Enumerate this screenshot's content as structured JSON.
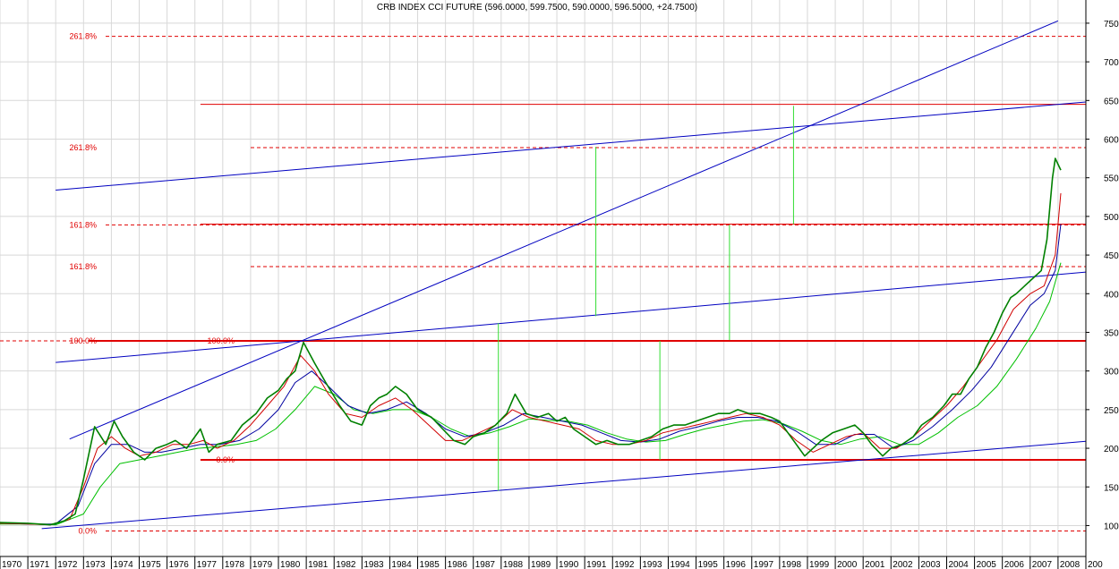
{
  "chart_data": {
    "type": "line",
    "title": "CRB INDEX CCI FUTURE (596.0000, 599.7500, 590.0000, 596.5000, +24.7500)",
    "xlim": [
      1970,
      2009
    ],
    "ylim": [
      60,
      780
    ],
    "y_ticks": [
      100,
      150,
      200,
      250,
      300,
      350,
      400,
      450,
      500,
      550,
      600,
      650,
      700,
      750
    ],
    "x_ticks": [
      "1970",
      "1971",
      "1972",
      "1973",
      "1974",
      "1975",
      "1976",
      "1977",
      "1978",
      "1979",
      "1980",
      "1981",
      "1982",
      "1983",
      "1984",
      "1985",
      "1986",
      "1987",
      "1988",
      "1989",
      "1990",
      "1991",
      "1992",
      "1993",
      "1994",
      "1995",
      "1996",
      "1997",
      "1998",
      "1999",
      "2000",
      "2001",
      "2002",
      "2003",
      "2004",
      "2005",
      "2006",
      "2007",
      "2008",
      "200"
    ],
    "grid": true,
    "series": [
      {
        "color": "#008000",
        "x": [
          1970,
          1971,
          1971.8,
          1972.3,
          1972.7,
          1973.0,
          1973.4,
          1973.8,
          1974.1,
          1974.4,
          1974.8,
          1975.2,
          1975.6,
          1976.0,
          1976.3,
          1976.7,
          1977.2,
          1977.5,
          1977.8,
          1978.3,
          1978.7,
          1979.2,
          1979.6,
          1980.0,
          1980.3,
          1980.6,
          1980.9,
          1981.3,
          1981.7,
          1982.2,
          1982.6,
          1983.0,
          1983.3,
          1983.6,
          1983.9,
          1984.2,
          1984.6,
          1985.0,
          1985.5,
          1985.9,
          1986.3,
          1986.7,
          1987.0,
          1987.4,
          1987.8,
          1988.2,
          1988.5,
          1988.9,
          1989.3,
          1989.7,
          1990.0,
          1990.3,
          1990.6,
          1991.0,
          1991.4,
          1991.8,
          1992.2,
          1992.6,
          1993.0,
          1993.4,
          1993.8,
          1994.2,
          1994.6,
          1995.0,
          1995.4,
          1995.8,
          1996.2,
          1996.5,
          1996.9,
          1997.3,
          1997.7,
          1998.0,
          1998.3,
          1998.6,
          1998.9,
          1999.2,
          1999.5,
          1999.9,
          2000.3,
          2000.7,
          2001.0,
          2001.3,
          2001.7,
          2002.0,
          2002.4,
          2002.8,
          2003.1,
          2003.5,
          2003.9,
          2004.2,
          2004.5,
          2004.8,
          2005.1,
          2005.4,
          2005.7,
          2006.0,
          2006.3,
          2006.5,
          2006.8,
          2007.1,
          2007.4,
          2007.6,
          2007.8,
          2007.9,
          2008.1
        ],
        "y": [
          104,
          103,
          101,
          106,
          115,
          160,
          228,
          205,
          235,
          215,
          195,
          185,
          200,
          205,
          210,
          200,
          225,
          195,
          205,
          210,
          230,
          245,
          265,
          275,
          290,
          300,
          337,
          310,
          285,
          255,
          235,
          230,
          255,
          265,
          270,
          280,
          270,
          250,
          240,
          225,
          210,
          205,
          215,
          220,
          230,
          245,
          270,
          245,
          240,
          245,
          235,
          240,
          225,
          215,
          205,
          210,
          205,
          205,
          210,
          215,
          225,
          230,
          230,
          235,
          240,
          245,
          245,
          250,
          245,
          245,
          240,
          235,
          220,
          205,
          190,
          200,
          210,
          220,
          225,
          230,
          220,
          205,
          190,
          200,
          205,
          215,
          230,
          240,
          255,
          270,
          270,
          290,
          305,
          330,
          350,
          375,
          395,
          400,
          410,
          420,
          430,
          470,
          550,
          575,
          560
        ]
      },
      {
        "color": "#d00000",
        "x": [
          1970,
          1971,
          1971.8,
          1972.5,
          1973.0,
          1973.5,
          1974.0,
          1974.5,
          1975.0,
          1975.6,
          1976.2,
          1976.8,
          1977.3,
          1977.8,
          1978.4,
          1979.0,
          1979.6,
          1980.2,
          1980.8,
          1981.3,
          1981.8,
          1982.4,
          1983.0,
          1983.6,
          1984.2,
          1984.8,
          1985.4,
          1986.0,
          1986.6,
          1987.2,
          1987.8,
          1988.4,
          1989.0,
          1989.6,
          1990.2,
          1990.8,
          1991.4,
          1992.0,
          1992.6,
          1993.2,
          1993.8,
          1994.4,
          1995.0,
          1995.6,
          1996.2,
          1996.8,
          1997.4,
          1998.0,
          1998.6,
          1999.2,
          1999.8,
          2000.4,
          2001.0,
          2001.6,
          2002.2,
          2002.8,
          2003.4,
          2004.0,
          2004.6,
          2005.2,
          2005.8,
          2006.4,
          2007.0,
          2007.5,
          2007.9,
          2008.1
        ],
        "y": [
          103,
          102,
          101,
          108,
          150,
          200,
          215,
          200,
          190,
          195,
          205,
          205,
          210,
          200,
          210,
          230,
          255,
          280,
          320,
          300,
          270,
          245,
          240,
          255,
          265,
          250,
          230,
          210,
          210,
          220,
          230,
          250,
          240,
          235,
          230,
          225,
          210,
          205,
          205,
          210,
          220,
          225,
          230,
          235,
          240,
          245,
          240,
          230,
          210,
          195,
          205,
          215,
          220,
          200,
          200,
          215,
          235,
          255,
          280,
          310,
          340,
          380,
          400,
          410,
          450,
          530
        ]
      },
      {
        "color": "#0000a0",
        "x": [
          1970,
          1971,
          1972,
          1972.8,
          1973.4,
          1974.0,
          1974.6,
          1975.2,
          1975.8,
          1976.5,
          1977.2,
          1977.9,
          1978.6,
          1979.3,
          1980.0,
          1980.6,
          1981.2,
          1981.8,
          1982.5,
          1983.2,
          1983.9,
          1984.6,
          1985.3,
          1986.0,
          1986.7,
          1987.4,
          1988.1,
          1988.8,
          1989.5,
          1990.2,
          1990.9,
          1991.6,
          1992.3,
          1993.0,
          1993.7,
          1994.4,
          1995.1,
          1995.8,
          1996.5,
          1997.2,
          1997.9,
          1998.6,
          1999.3,
          2000.0,
          2000.7,
          2001.4,
          2002.1,
          2002.8,
          2003.5,
          2004.2,
          2004.9,
          2005.6,
          2006.3,
          2007.0,
          2007.5,
          2007.9,
          2008.1
        ],
        "y": [
          103,
          102,
          102,
          125,
          180,
          205,
          205,
          195,
          195,
          200,
          205,
          205,
          210,
          225,
          250,
          285,
          300,
          280,
          255,
          245,
          250,
          260,
          245,
          225,
          215,
          220,
          230,
          245,
          240,
          235,
          230,
          220,
          210,
          208,
          212,
          222,
          228,
          235,
          240,
          240,
          235,
          222,
          205,
          205,
          218,
          218,
          200,
          210,
          228,
          250,
          275,
          305,
          345,
          385,
          400,
          430,
          490
        ]
      },
      {
        "color": "#00c000",
        "x": [
          1970,
          1971,
          1972,
          1973,
          1973.6,
          1974.3,
          1975.0,
          1975.7,
          1976.4,
          1977.1,
          1977.8,
          1978.5,
          1979.2,
          1979.9,
          1980.6,
          1981.3,
          1982.0,
          1982.7,
          1983.4,
          1984.1,
          1984.8,
          1985.5,
          1986.2,
          1986.9,
          1987.6,
          1988.3,
          1989.0,
          1989.7,
          1990.4,
          1991.1,
          1991.8,
          1992.5,
          1993.2,
          1993.9,
          1994.6,
          1995.3,
          1996.0,
          1996.7,
          1997.4,
          1998.1,
          1998.8,
          1999.5,
          2000.2,
          2000.9,
          2001.6,
          2002.3,
          2003.0,
          2003.7,
          2004.4,
          2005.1,
          2005.8,
          2006.5,
          2007.2,
          2007.7,
          2008.1
        ],
        "y": [
          102,
          102,
          101,
          115,
          150,
          180,
          185,
          190,
          195,
          200,
          202,
          205,
          210,
          225,
          250,
          280,
          270,
          250,
          245,
          250,
          250,
          240,
          225,
          215,
          220,
          228,
          238,
          236,
          235,
          230,
          220,
          212,
          208,
          210,
          218,
          225,
          230,
          235,
          237,
          232,
          222,
          210,
          205,
          212,
          215,
          205,
          205,
          220,
          240,
          255,
          280,
          315,
          355,
          390,
          440
        ]
      }
    ],
    "fib_levels": [
      {
        "label": "261.8%",
        "y": 733
      },
      {
        "label": "261.8%",
        "y": 589
      },
      {
        "label": "161.8%",
        "y": 489
      },
      {
        "label": "161.8%",
        "y": 435
      },
      {
        "label": "100.0%",
        "y": 339
      },
      {
        "label": "100.0%",
        "y": 339
      },
      {
        "label": "0.0%",
        "y": 185
      },
      {
        "label": "0.0%",
        "y": 93
      }
    ],
    "hlines": [
      {
        "y": 645,
        "x1": 1977.2,
        "x2": 2009
      },
      {
        "y": 490,
        "x1": 1977.2,
        "x2": 2009
      },
      {
        "y": 339,
        "x1": 1973.2,
        "x2": 2009
      },
      {
        "y": 185,
        "x1": 1977.2,
        "x2": 2009
      }
    ],
    "trendlines": [
      {
        "x1": 1972.0,
        "y1": 534,
        "x2": 2009,
        "y2": 648
      },
      {
        "x1": 1972.5,
        "y1": 212,
        "x2": 2008.0,
        "y2": 753
      },
      {
        "x1": 1972.0,
        "y1": 311,
        "x2": 2009,
        "y2": 428
      },
      {
        "x1": 1971.5,
        "y1": 96,
        "x2": 2009,
        "y2": 209
      }
    ],
    "vlines": [
      {
        "x": 1987.9,
        "y1": 145,
        "y2": 362
      },
      {
        "x": 1991.4,
        "y1": 371,
        "y2": 590
      },
      {
        "x": 1993.7,
        "y1": 185,
        "y2": 339
      },
      {
        "x": 1996.2,
        "y1": 340,
        "y2": 489
      },
      {
        "x": 1998.5,
        "y1": 490,
        "y2": 643
      }
    ]
  }
}
